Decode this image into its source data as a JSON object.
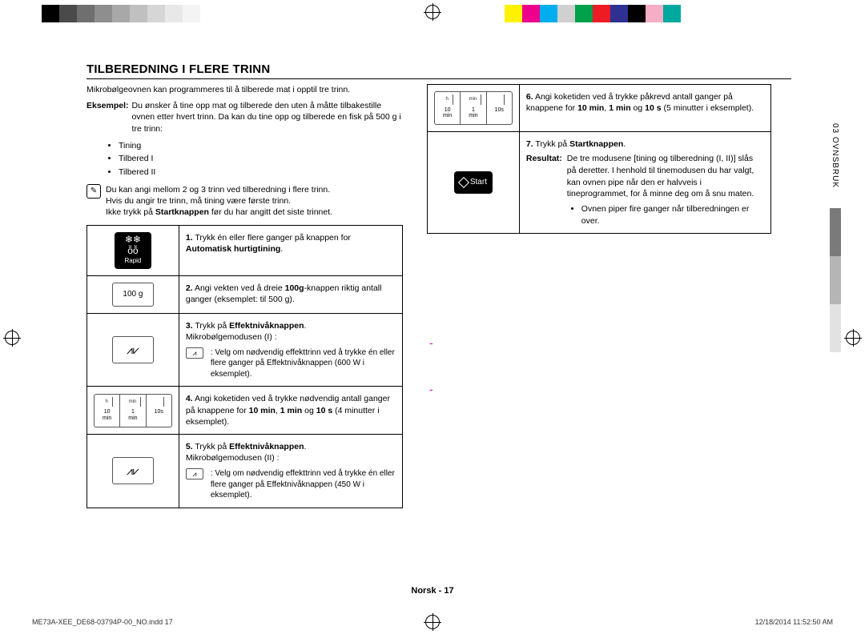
{
  "header": {
    "title": "TILBEREDNING I FLERE TRINN"
  },
  "intro": "Mikrobølgeovnen kan programmeres til å tilberede mat i opptil tre trinn.",
  "example": {
    "label": "Eksempel:",
    "text": "Du ønsker å tine opp mat og tilberede den uten å måtte tilbakestille ovnen etter hvert trinn. Da kan du tine opp og tilberede en fisk på 500 g i tre trinn:"
  },
  "stage_list": [
    "Tining",
    "Tilbered I",
    "Tilbered II"
  ],
  "note": {
    "line1": "Du kan angi mellom 2 og 3 trinn ved tilberedning i flere trinn.",
    "line2": "Hvis du angir tre trinn, må tining være første trinn.",
    "line3_pre": "Ikke trykk på ",
    "line3_bold": "Startknappen",
    "line3_post": " før du har angitt det siste trinnet."
  },
  "buttons": {
    "rapid_label": "Rapid",
    "weight_label": "100 g",
    "time_h": "h",
    "time_10min": "10 min",
    "time_min": "min",
    "time_1min": "1 min",
    "time_10s": "10s",
    "start_label": "Start"
  },
  "steps": [
    {
      "num": "1.",
      "text_pre": "Trykk én eller flere ganger på knappen for ",
      "bold": "Automatisk hurtigtining",
      "text_post": "."
    },
    {
      "num": "2.",
      "text_pre": "Angi vekten ved å dreie ",
      "bold": "100g",
      "text_post": "-knappen riktig antall ganger (eksemplet: til 500 g)."
    },
    {
      "num": "3.",
      "text_pre": "Trykk på ",
      "bold": "Effektnivåknappen",
      "text_post": ".",
      "extra_plain": "Mikrobølgemodusen (I) :",
      "subnote": ": Velg om nødvendig effekttrinn ved å trykke én eller flere ganger på Effektnivåknappen (600 W i eksemplet)."
    },
    {
      "num": "4.",
      "text": "Angi koketiden ved å trykke nødvendig antall ganger på knappene for ",
      "b1": "10 min",
      "mid1": ", ",
      "b2": "1 min",
      "mid2": " og ",
      "b3": "10 s",
      "tail": " (4 minutter i eksemplet)."
    },
    {
      "num": "5.",
      "text_pre": "Trykk på ",
      "bold": "Effektnivåknappen",
      "text_post": ".",
      "extra_plain": "Mikrobølgemodusen (II) :",
      "subnote": ": Velg om nødvendig effekttrinn ved å trykke én eller flere ganger på Effektnivåknappen (450 W i eksemplet)."
    },
    {
      "num": "6.",
      "text": "Angi koketiden ved å trykke påkrevd antall ganger på knappene for ",
      "b1": "10 min",
      "mid1": ", ",
      "b2": "1 min",
      "mid2": " og ",
      "b3": "10 s",
      "tail": " (5 minutter i eksemplet)."
    },
    {
      "num": "7.",
      "text_pre": "Trykk på ",
      "bold": "Startknappen",
      "text_post": ".",
      "result_label": "Resultat:",
      "result_text": "De tre modusene [tining og tilberedning (I, II)] slås på deretter. I henhold til tinemodusen du har valgt, kan ovnen pipe når den er halvveis i tineprogrammet, for å minne deg om å snu maten.",
      "result_bullet": "Ovnen piper fire ganger når tilberedningen er over."
    }
  ],
  "side_tab": "03  OVNSBRUK",
  "footer_center": "Norsk - 17",
  "print": {
    "file": "ME73A-XEE_DE68-03794P-00_NO.indd   17",
    "date": "12/18/2014   11:52:50 AM"
  },
  "colors": {
    "top_left": [
      "#fff",
      "#000",
      "#4a4a4a",
      "#6f6f6f",
      "#8e8e8e",
      "#a8a8a8",
      "#c0c0c0",
      "#d6d6d6",
      "#e8e8e8",
      "#f4f4f4"
    ],
    "top_right": [
      "#fff200",
      "#ec008c",
      "#00adef",
      "#d0d0d0",
      "#00a14b",
      "#ed1c24",
      "#2e3192",
      "#000",
      "#f6adc6",
      "#00a99d"
    ]
  }
}
